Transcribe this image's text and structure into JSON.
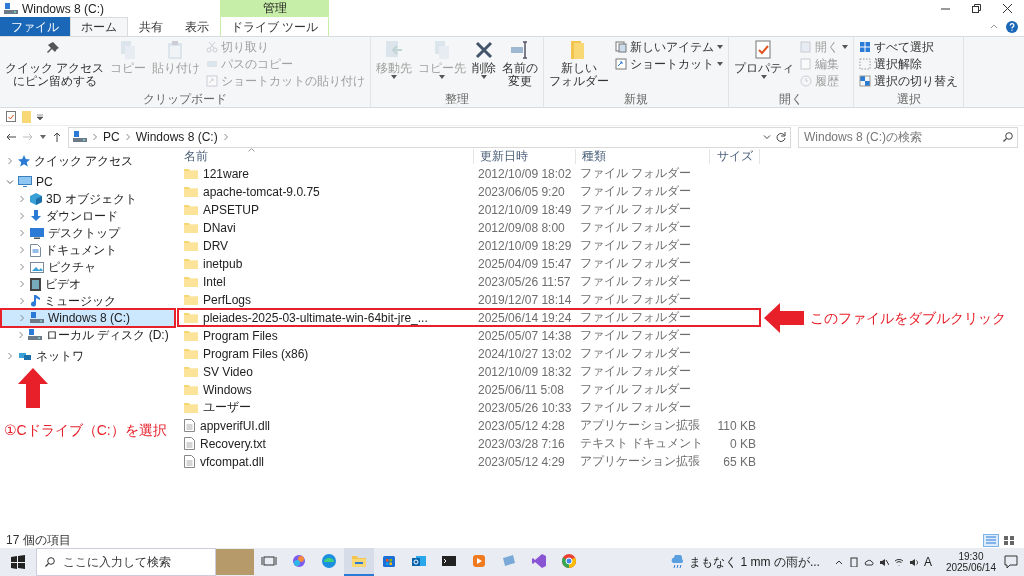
{
  "window": {
    "title": "Windows 8 (C:)",
    "context_header": "管理"
  },
  "tabs": [
    {
      "label": "ファイル",
      "kind": "file",
      "selected": false
    },
    {
      "label": "ホーム",
      "kind": "normal",
      "selected": true
    },
    {
      "label": "共有",
      "kind": "normal",
      "selected": false
    },
    {
      "label": "表示",
      "kind": "normal",
      "selected": false
    },
    {
      "label": "ドライブ ツール",
      "kind": "context",
      "selected": false
    }
  ],
  "ribbon": {
    "groups": [
      {
        "label": "クリップボード",
        "items": [
          {
            "kind": "large",
            "lines": [
              "クイック アクセス",
              "にピン留めする"
            ],
            "disabled": false,
            "dropdown": false
          },
          {
            "kind": "large",
            "lines": [
              "コピー"
            ],
            "disabled": true,
            "dropdown": false
          },
          {
            "kind": "large",
            "lines": [
              "貼り付け"
            ],
            "disabled": true,
            "dropdown": false
          },
          {
            "kind": "small",
            "label": "切り取り",
            "disabled": true,
            "dropdown": false
          },
          {
            "kind": "small",
            "label": "パスのコピー",
            "disabled": true,
            "dropdown": false
          },
          {
            "kind": "small",
            "label": "ショートカットの貼り付け",
            "disabled": true,
            "dropdown": false
          }
        ]
      },
      {
        "label": "整理",
        "items": [
          {
            "kind": "large",
            "lines": [
              "移動先"
            ],
            "disabled": true,
            "dropdown": true
          },
          {
            "kind": "large",
            "lines": [
              "コピー先"
            ],
            "disabled": true,
            "dropdown": true
          },
          {
            "kind": "large",
            "lines": [
              "削除"
            ],
            "disabled": false,
            "dropdown": true
          },
          {
            "kind": "large",
            "lines": [
              "名前の",
              "変更"
            ],
            "disabled": false,
            "dropdown": false
          }
        ]
      },
      {
        "label": "新規",
        "items": [
          {
            "kind": "large",
            "lines": [
              "新しい",
              "フォルダー"
            ],
            "disabled": false,
            "dropdown": false
          },
          {
            "kind": "small",
            "label": "新しいアイテム",
            "disabled": false,
            "dropdown": true
          },
          {
            "kind": "small",
            "label": "ショートカット",
            "disabled": false,
            "dropdown": true
          }
        ]
      },
      {
        "label": "開く",
        "items": [
          {
            "kind": "large",
            "lines": [
              "プロパティ"
            ],
            "disabled": false,
            "dropdown": true
          },
          {
            "kind": "small",
            "label": "開く",
            "disabled": true,
            "dropdown": true
          },
          {
            "kind": "small",
            "label": "編集",
            "disabled": true,
            "dropdown": false
          },
          {
            "kind": "small",
            "label": "履歴",
            "disabled": true,
            "dropdown": false
          }
        ]
      },
      {
        "label": "選択",
        "items": [
          {
            "kind": "small",
            "label": "すべて選択",
            "disabled": false,
            "dropdown": false
          },
          {
            "kind": "small",
            "label": "選択解除",
            "disabled": false,
            "dropdown": false
          },
          {
            "kind": "small",
            "label": "選択の切り替え",
            "disabled": false,
            "dropdown": false
          }
        ]
      }
    ]
  },
  "address": {
    "crumbs": [
      "PC",
      "Windows 8 (C:)"
    ],
    "search_placeholder": "Windows 8 (C:)の検索"
  },
  "nav_tree": [
    {
      "label": "クイック アクセス",
      "kind": "quick",
      "expanded": false,
      "selected": false,
      "marked": false
    },
    {
      "label": "PC",
      "kind": "pc",
      "expanded": true,
      "selected": false,
      "marked": false,
      "children": [
        {
          "label": "3D オブジェクト",
          "kind": "objects3d",
          "expanded": false,
          "selected": false,
          "marked": false
        },
        {
          "label": "ダウンロード",
          "kind": "downloads",
          "expanded": false,
          "selected": false,
          "marked": false
        },
        {
          "label": "デスクトップ",
          "kind": "desktop",
          "expanded": false,
          "selected": false,
          "marked": false
        },
        {
          "label": "ドキュメント",
          "kind": "documents",
          "expanded": false,
          "selected": false,
          "marked": false
        },
        {
          "label": "ピクチャ",
          "kind": "pictures",
          "expanded": false,
          "selected": false,
          "marked": false
        },
        {
          "label": "ビデオ",
          "kind": "videos",
          "expanded": false,
          "selected": false,
          "marked": false
        },
        {
          "label": "ミュージック",
          "kind": "music",
          "expanded": false,
          "selected": false,
          "marked": false
        },
        {
          "label": "Windows 8 (C:)",
          "kind": "drive",
          "expanded": false,
          "selected": true,
          "marked": true
        },
        {
          "label": "ローカル ディスク (D:)",
          "kind": "drive",
          "expanded": false,
          "selected": false,
          "marked": false
        }
      ]
    },
    {
      "label": "ネットワ",
      "kind": "network",
      "expanded": false,
      "selected": false,
      "marked": false
    }
  ],
  "file_list": {
    "columns": [
      "名前",
      "更新日時",
      "種類",
      "サイズ"
    ],
    "rows": [
      {
        "name": "121ware",
        "modified": "2012/10/09 18:02",
        "type": "ファイル フォルダー",
        "size": "",
        "kind": "folder",
        "marked": false
      },
      {
        "name": "apache-tomcat-9.0.75",
        "modified": "2023/06/05 9:20",
        "type": "ファイル フォルダー",
        "size": "",
        "kind": "folder",
        "marked": false
      },
      {
        "name": "APSETUP",
        "modified": "2012/10/09 18:49",
        "type": "ファイル フォルダー",
        "size": "",
        "kind": "folder",
        "marked": false
      },
      {
        "name": "DNavi",
        "modified": "2012/09/08 8:00",
        "type": "ファイル フォルダー",
        "size": "",
        "kind": "folder",
        "marked": false
      },
      {
        "name": "DRV",
        "modified": "2012/10/09 18:29",
        "type": "ファイル フォルダー",
        "size": "",
        "kind": "folder",
        "marked": false
      },
      {
        "name": "inetpub",
        "modified": "2025/04/09 15:47",
        "type": "ファイル フォルダー",
        "size": "",
        "kind": "folder",
        "marked": false
      },
      {
        "name": "Intel",
        "modified": "2023/05/26 11:57",
        "type": "ファイル フォルダー",
        "size": "",
        "kind": "folder",
        "marked": false
      },
      {
        "name": "PerfLogs",
        "modified": "2019/12/07 18:14",
        "type": "ファイル フォルダー",
        "size": "",
        "kind": "folder",
        "marked": false
      },
      {
        "name": "pleiades-2025-03-ultimate-win-64bit-jre_...",
        "modified": "2025/06/14 19:24",
        "type": "ファイル フォルダー",
        "size": "",
        "kind": "folder",
        "marked": true
      },
      {
        "name": "Program Files",
        "modified": "2025/05/07 14:38",
        "type": "ファイル フォルダー",
        "size": "",
        "kind": "folder",
        "marked": false
      },
      {
        "name": "Program Files (x86)",
        "modified": "2024/10/27 13:02",
        "type": "ファイル フォルダー",
        "size": "",
        "kind": "folder",
        "marked": false
      },
      {
        "name": "SV Video",
        "modified": "2012/10/09 18:32",
        "type": "ファイル フォルダー",
        "size": "",
        "kind": "folder",
        "marked": false
      },
      {
        "name": "Windows",
        "modified": "2025/06/11 5:08",
        "type": "ファイル フォルダー",
        "size": "",
        "kind": "folder",
        "marked": false
      },
      {
        "name": "ユーザー",
        "modified": "2023/05/26 10:33",
        "type": "ファイル フォルダー",
        "size": "",
        "kind": "folder",
        "marked": false
      },
      {
        "name": "appverifUI.dll",
        "modified": "2023/05/12 4:28",
        "type": "アプリケーション拡張",
        "size": "110 KB",
        "kind": "dll",
        "marked": false
      },
      {
        "name": "Recovery.txt",
        "modified": "2023/03/28 7:16",
        "type": "テキスト ドキュメント",
        "size": "0 KB",
        "kind": "text",
        "marked": false
      },
      {
        "name": "vfcompat.dll",
        "modified": "2023/05/12 4:29",
        "type": "アプリケーション拡張",
        "size": "65 KB",
        "kind": "dll",
        "marked": false
      }
    ]
  },
  "status_bar": {
    "item_count": "17 個の項目",
    "view_buttons": [
      {
        "selected": true
      },
      {
        "selected": false
      }
    ]
  },
  "taskbar": {
    "search_placeholder": "ここに入力して検索",
    "apps": [
      {
        "active": false
      },
      {
        "active": false
      },
      {
        "active": false
      },
      {
        "active": true
      },
      {
        "active": false
      },
      {
        "active": false
      },
      {
        "active": false
      },
      {
        "active": false
      },
      {
        "active": false
      },
      {
        "active": false
      },
      {
        "active": false
      }
    ],
    "weather": "まもなく 1 mm の雨が...",
    "ime": "A",
    "time": "19:30",
    "date": "2025/06/14"
  },
  "callouts": [
    {
      "kind": "arrow-left",
      "text": "このファイルをダブルクリック"
    },
    {
      "kind": "arrow-up",
      "text": "①Cドライブ（C:）を選択"
    }
  ]
}
